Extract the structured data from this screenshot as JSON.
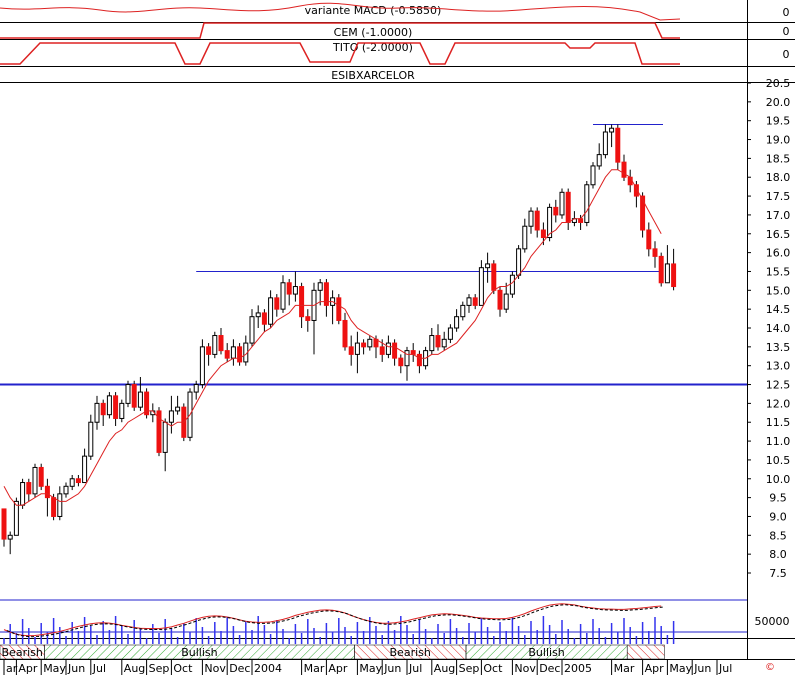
{
  "chart_data": {
    "type": "candlestick",
    "title": "ESIBXARCELOR",
    "colors": {
      "up": "#ffffff",
      "down": "#ee1111",
      "ma": "#dd2222",
      "hline": "#2222cc",
      "volume": "#3333ee",
      "grid": "#000000",
      "bullish_hatch": "#33aa33",
      "bearish_hatch": "#dd2222"
    },
    "price_axis": {
      "min": 7.5,
      "max": 20.5,
      "ticks": [
        "20.5",
        "20.0",
        "19.5",
        "19.0",
        "18.5",
        "18.0",
        "17.5",
        "17.0",
        "16.5",
        "16.0",
        "15.5",
        "15.0",
        "14.5",
        "14.0",
        "13.5",
        "13.0",
        "12.5",
        "12.0",
        "11.5",
        "11.0",
        "10.5",
        "10.0",
        "9.5",
        "9.0",
        "8.5",
        "8.0",
        "7.5"
      ]
    },
    "hlines": [
      {
        "value": 12.5,
        "from_index": 0
      },
      {
        "value": 15.5,
        "from_index": 31
      },
      {
        "value": 19.4,
        "from_index": 95
      }
    ],
    "x_labels": [
      {
        "label": "ar",
        "i": 0
      },
      {
        "label": "Apr",
        "i": 2
      },
      {
        "label": "May",
        "i": 6
      },
      {
        "label": "Jun",
        "i": 10
      },
      {
        "label": "Jul",
        "i": 14
      },
      {
        "label": "Aug",
        "i": 19
      },
      {
        "label": "Sep",
        "i": 23
      },
      {
        "label": "Oct",
        "i": 27
      },
      {
        "label": "Nov",
        "i": 32
      },
      {
        "label": "Dec",
        "i": 36
      },
      {
        "label": "2004",
        "i": 40
      },
      {
        "label": "Mar",
        "i": 48
      },
      {
        "label": "Apr",
        "i": 52
      },
      {
        "label": "May",
        "i": 57
      },
      {
        "label": "Jun",
        "i": 61
      },
      {
        "label": "Jul",
        "i": 65
      },
      {
        "label": "Aug",
        "i": 69
      },
      {
        "label": "Sep",
        "i": 73
      },
      {
        "label": "Oct",
        "i": 77
      },
      {
        "label": "Nov",
        "i": 82
      },
      {
        "label": "Dec",
        "i": 86
      },
      {
        "label": "2005",
        "i": 90
      },
      {
        "label": "Mar",
        "i": 98
      },
      {
        "label": "Apr",
        "i": 103
      },
      {
        "label": "May",
        "i": 107
      },
      {
        "label": "Jun",
        "i": 111
      },
      {
        "label": "Jul",
        "i": 115
      }
    ],
    "candles": [
      [
        9.2,
        8.4,
        9.2,
        8.2
      ],
      [
        8.4,
        8.5,
        8.6,
        8.0
      ],
      [
        8.5,
        9.4,
        9.5,
        8.5
      ],
      [
        9.3,
        9.9,
        10.0,
        9.2
      ],
      [
        9.9,
        9.6,
        10.0,
        9.4
      ],
      [
        9.6,
        10.3,
        10.4,
        9.5
      ],
      [
        10.3,
        9.8,
        10.4,
        9.7
      ],
      [
        9.8,
        9.5,
        10.0,
        9.0
      ],
      [
        9.5,
        9.0,
        9.6,
        8.9
      ],
      [
        9.0,
        9.6,
        9.8,
        8.9
      ],
      [
        9.6,
        9.8,
        9.9,
        9.5
      ],
      [
        9.8,
        10.0,
        10.1,
        9.7
      ],
      [
        10.0,
        9.9,
        10.1,
        9.8
      ],
      [
        9.9,
        10.6,
        10.8,
        9.9
      ],
      [
        10.6,
        11.5,
        11.7,
        10.5
      ],
      [
        11.5,
        12.0,
        12.2,
        11.3
      ],
      [
        12.0,
        11.7,
        12.1,
        11.4
      ],
      [
        11.7,
        12.2,
        12.3,
        11.6
      ],
      [
        12.2,
        11.6,
        12.3,
        11.4
      ],
      [
        11.6,
        12.0,
        12.1,
        11.5
      ],
      [
        12.0,
        12.5,
        12.6,
        11.9
      ],
      [
        12.5,
        11.9,
        12.6,
        11.8
      ],
      [
        11.9,
        12.3,
        12.7,
        11.8
      ],
      [
        12.3,
        11.7,
        12.4,
        11.6
      ],
      [
        11.7,
        11.8,
        12.0,
        11.5
      ],
      [
        11.8,
        10.7,
        11.9,
        10.6
      ],
      [
        10.7,
        11.5,
        11.6,
        10.2
      ],
      [
        11.5,
        11.8,
        12.2,
        11.2
      ],
      [
        11.8,
        11.9,
        12.2,
        11.7
      ],
      [
        11.9,
        11.1,
        12.0,
        11.0
      ],
      [
        11.1,
        12.3,
        12.4,
        11.0
      ],
      [
        12.3,
        12.5,
        12.6,
        12.1
      ],
      [
        12.5,
        13.5,
        13.7,
        12.4
      ],
      [
        13.5,
        13.3,
        13.6,
        13.0
      ],
      [
        13.3,
        13.8,
        13.9,
        13.2
      ],
      [
        13.8,
        13.4,
        14.0,
        13.3
      ],
      [
        13.4,
        13.2,
        13.6,
        13.1
      ],
      [
        13.2,
        13.5,
        13.7,
        13.0
      ],
      [
        13.5,
        13.1,
        13.6,
        13.0
      ],
      [
        13.1,
        13.6,
        13.8,
        13.0
      ],
      [
        13.6,
        14.3,
        14.5,
        13.5
      ],
      [
        14.3,
        14.4,
        14.6,
        14.0
      ],
      [
        14.4,
        14.1,
        14.5,
        13.9
      ],
      [
        14.1,
        14.8,
        15.0,
        14.0
      ],
      [
        14.8,
        14.5,
        14.9,
        14.3
      ],
      [
        14.5,
        15.2,
        15.4,
        14.4
      ],
      [
        15.2,
        14.9,
        15.3,
        14.6
      ],
      [
        14.9,
        15.1,
        15.5,
        14.7
      ],
      [
        15.1,
        14.3,
        15.2,
        14.0
      ],
      [
        14.3,
        14.2,
        14.5,
        13.9
      ],
      [
        14.2,
        15.0,
        15.2,
        13.3
      ],
      [
        15.0,
        15.2,
        15.3,
        14.6
      ],
      [
        15.2,
        14.6,
        15.3,
        14.3
      ],
      [
        14.6,
        14.8,
        15.0,
        14.1
      ],
      [
        14.8,
        14.2,
        14.9,
        14.1
      ],
      [
        14.2,
        13.5,
        14.4,
        13.4
      ],
      [
        13.5,
        13.3,
        13.8,
        13.0
      ],
      [
        13.3,
        13.6,
        13.9,
        12.8
      ],
      [
        13.6,
        13.5,
        13.7,
        13.3
      ],
      [
        13.5,
        13.7,
        13.8,
        13.4
      ],
      [
        13.7,
        13.5,
        13.8,
        13.2
      ],
      [
        13.5,
        13.3,
        13.7,
        13.1
      ],
      [
        13.3,
        13.6,
        13.8,
        13.2
      ],
      [
        13.6,
        13.2,
        13.7,
        13.0
      ],
      [
        13.2,
        13.0,
        13.3,
        12.8
      ],
      [
        13.0,
        13.4,
        13.5,
        12.6
      ],
      [
        13.4,
        13.3,
        13.6,
        13.1
      ],
      [
        13.3,
        13.0,
        13.4,
        12.8
      ],
      [
        13.0,
        13.4,
        13.5,
        12.9
      ],
      [
        13.4,
        13.8,
        14.0,
        13.3
      ],
      [
        13.8,
        13.5,
        14.1,
        13.4
      ],
      [
        13.5,
        13.7,
        13.9,
        13.4
      ],
      [
        13.7,
        14.0,
        14.1,
        13.6
      ],
      [
        14.0,
        14.3,
        14.5,
        13.9
      ],
      [
        14.3,
        14.6,
        14.7,
        14.2
      ],
      [
        14.6,
        14.8,
        14.9,
        14.4
      ],
      [
        14.8,
        14.6,
        14.9,
        14.5
      ],
      [
        14.6,
        15.6,
        15.8,
        14.6
      ],
      [
        15.6,
        15.7,
        16.0,
        15.2
      ],
      [
        15.7,
        15.0,
        15.8,
        14.9
      ],
      [
        15.0,
        14.5,
        15.1,
        14.3
      ],
      [
        14.5,
        14.9,
        15.2,
        14.4
      ],
      [
        14.9,
        15.4,
        15.5,
        14.8
      ],
      [
        15.4,
        16.1,
        16.2,
        15.3
      ],
      [
        16.1,
        16.7,
        16.9,
        16.0
      ],
      [
        16.7,
        17.1,
        17.2,
        16.5
      ],
      [
        17.1,
        16.6,
        17.2,
        16.4
      ],
      [
        16.6,
        16.4,
        16.8,
        16.2
      ],
      [
        16.4,
        17.2,
        17.3,
        16.3
      ],
      [
        17.2,
        17.0,
        17.4,
        16.8
      ],
      [
        17.0,
        17.6,
        17.7,
        16.9
      ],
      [
        17.6,
        16.8,
        17.7,
        16.6
      ],
      [
        16.8,
        16.9,
        17.1,
        16.7
      ],
      [
        16.9,
        16.8,
        17.0,
        16.6
      ],
      [
        16.8,
        17.8,
        17.9,
        16.7
      ],
      [
        17.8,
        18.3,
        18.4,
        17.7
      ],
      [
        18.3,
        18.6,
        18.9,
        18.2
      ],
      [
        18.6,
        19.2,
        19.4,
        18.5
      ],
      [
        19.2,
        19.3,
        19.4,
        18.8
      ],
      [
        19.3,
        18.4,
        19.4,
        18.2
      ],
      [
        18.4,
        18.0,
        18.6,
        17.9
      ],
      [
        18.0,
        17.8,
        18.2,
        17.6
      ],
      [
        17.8,
        17.5,
        17.9,
        17.2
      ],
      [
        17.5,
        16.6,
        17.6,
        16.4
      ],
      [
        16.6,
        16.1,
        16.8,
        15.9
      ],
      [
        16.1,
        15.9,
        16.3,
        15.6
      ],
      [
        15.9,
        15.2,
        16.0,
        15.1
      ],
      [
        15.2,
        15.7,
        16.2,
        15.2
      ],
      [
        15.7,
        15.1,
        16.1,
        15.0
      ]
    ],
    "ma": [
      9.8,
      9.5,
      9.3,
      9.3,
      9.4,
      9.5,
      9.6,
      9.6,
      9.5,
      9.4,
      9.4,
      9.5,
      9.6,
      9.8,
      10.1,
      10.4,
      10.7,
      11.0,
      11.2,
      11.3,
      11.5,
      11.6,
      11.7,
      11.8,
      11.8,
      11.6,
      11.5,
      11.4,
      11.5,
      11.5,
      11.7,
      12.0,
      12.3,
      12.6,
      12.8,
      13.0,
      13.1,
      13.2,
      13.2,
      13.3,
      13.5,
      13.7,
      13.9,
      14.0,
      14.2,
      14.3,
      14.4,
      14.6,
      14.6,
      14.6,
      14.6,
      14.7,
      14.7,
      14.7,
      14.6,
      14.5,
      14.2,
      14.0,
      13.9,
      13.8,
      13.7,
      13.6,
      13.5,
      13.5,
      13.4,
      13.3,
      13.3,
      13.2,
      13.2,
      13.3,
      13.3,
      13.4,
      13.5,
      13.6,
      13.8,
      14.0,
      14.2,
      14.5,
      14.8,
      15.0,
      15.1,
      15.1,
      15.2,
      15.4,
      15.6,
      15.9,
      16.1,
      16.3,
      16.5,
      16.6,
      16.8,
      16.8,
      16.9,
      16.9,
      17.1,
      17.4,
      17.7,
      18.0,
      18.2,
      18.2,
      18.1,
      18.0,
      17.7,
      17.4,
      17.1,
      16.8,
      16.5
    ],
    "indicator_top": {
      "label": "variante MACD (-0.5850)",
      "value_label": "0"
    },
    "indicator_cem": {
      "label": "CEM (-1.0000)",
      "value_label": "0"
    },
    "indicator_tito": {
      "label": "TITO (-2.0000)",
      "value_label": "0"
    },
    "volume_label": "50000",
    "phases": [
      {
        "label": "Bearish",
        "type": "bearish",
        "from": 0,
        "to": 7
      },
      {
        "label": "Bullish",
        "type": "bullish",
        "from": 7,
        "to": 57
      },
      {
        "label": "Bearish",
        "type": "bearish",
        "from": 57,
        "to": 75
      },
      {
        "label": "Bullish",
        "type": "bullish",
        "from": 75,
        "to": 101
      },
      {
        "label": "",
        "type": "bearish",
        "from": 101,
        "to": 107
      }
    ],
    "copyright_mark": "©"
  }
}
